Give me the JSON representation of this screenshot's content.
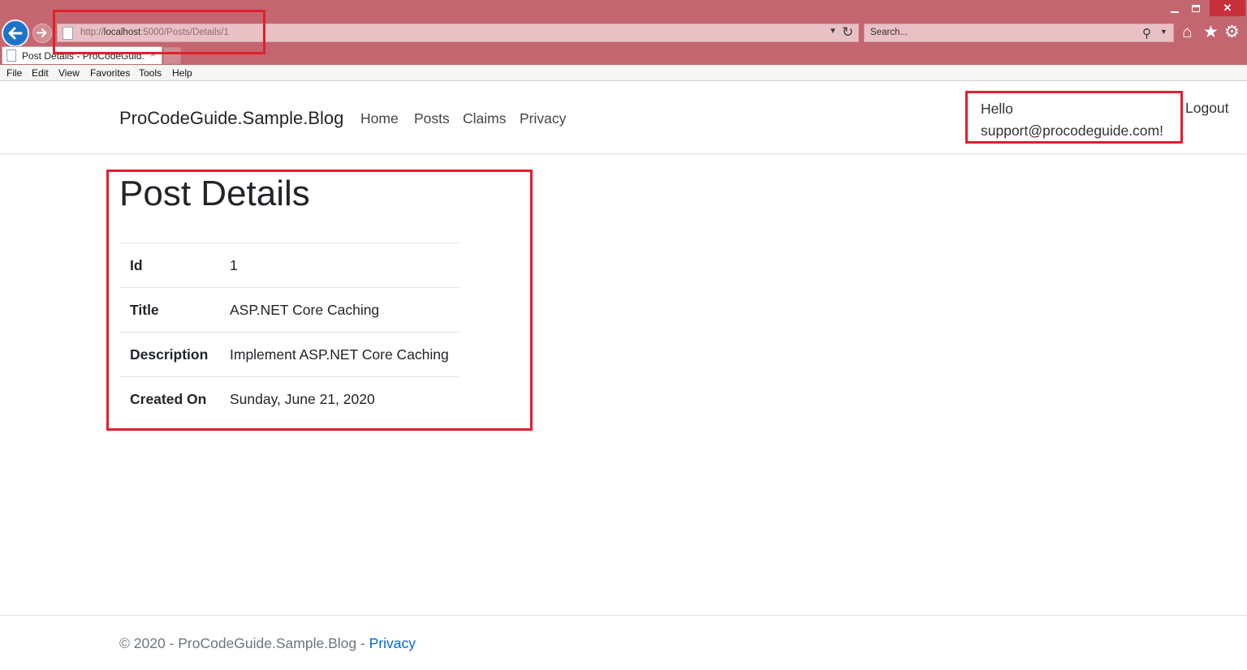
{
  "browser": {
    "url_prefix": "http://",
    "url_host": "localhost",
    "url_rest": ":5000/Posts/Details/1",
    "search_placeholder": "Search...",
    "tab_title": "Post Details - ProCodeGuid...",
    "tab_close": "×",
    "menu": [
      "File",
      "Edit",
      "View",
      "Favorites",
      "Tools",
      "Help"
    ],
    "close_glyph": "✕"
  },
  "navbar": {
    "brand": "ProCodeGuide.Sample.Blog",
    "links": [
      "Home",
      "Posts",
      "Claims",
      "Privacy"
    ],
    "hello_line1": "Hello",
    "hello_line2": "support@procodeguide.com!",
    "logout": "Logout"
  },
  "page": {
    "title": "Post Details",
    "rows": [
      {
        "label": "Id",
        "value": "1"
      },
      {
        "label": "Title",
        "value": "ASP.NET Core Caching"
      },
      {
        "label": "Description",
        "value": "Implement ASP.NET Core Caching"
      },
      {
        "label": "Created On",
        "value": "Sunday, June 21, 2020"
      }
    ]
  },
  "footer": {
    "text": "© 2020 - ProCodeGuide.Sample.Blog - ",
    "link": "Privacy"
  },
  "colors": {
    "chrome": "#c46670",
    "highlight": "#e0202c",
    "link": "#0366d6"
  }
}
